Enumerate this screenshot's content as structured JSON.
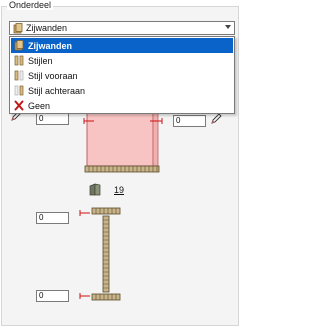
{
  "group_label": "Onderdeel",
  "combo": {
    "selected": "Zijwanden"
  },
  "options": [
    {
      "label": "Zijwanden",
      "icon": "side-panel-icon",
      "selected": true
    },
    {
      "label": "Stijlen",
      "icon": "stiles-icon",
      "selected": false
    },
    {
      "label": "Stijl vooraan",
      "icon": "front-stile-icon",
      "selected": false
    },
    {
      "label": "Stijl achteraan",
      "icon": "back-stile-icon",
      "selected": false
    },
    {
      "label": "Geen",
      "icon": "close-icon",
      "selected": false
    }
  ],
  "fields": {
    "top_left": "0",
    "top_right": "0",
    "lower_top": "0",
    "lower_bottom": "0"
  },
  "part_number": "19",
  "colors": {
    "selection": "#0a63c9",
    "panel_fill": "#f7c3c3",
    "panel_stroke": "#c06060",
    "wood": "#c8b48a",
    "marker": "#d01010"
  }
}
